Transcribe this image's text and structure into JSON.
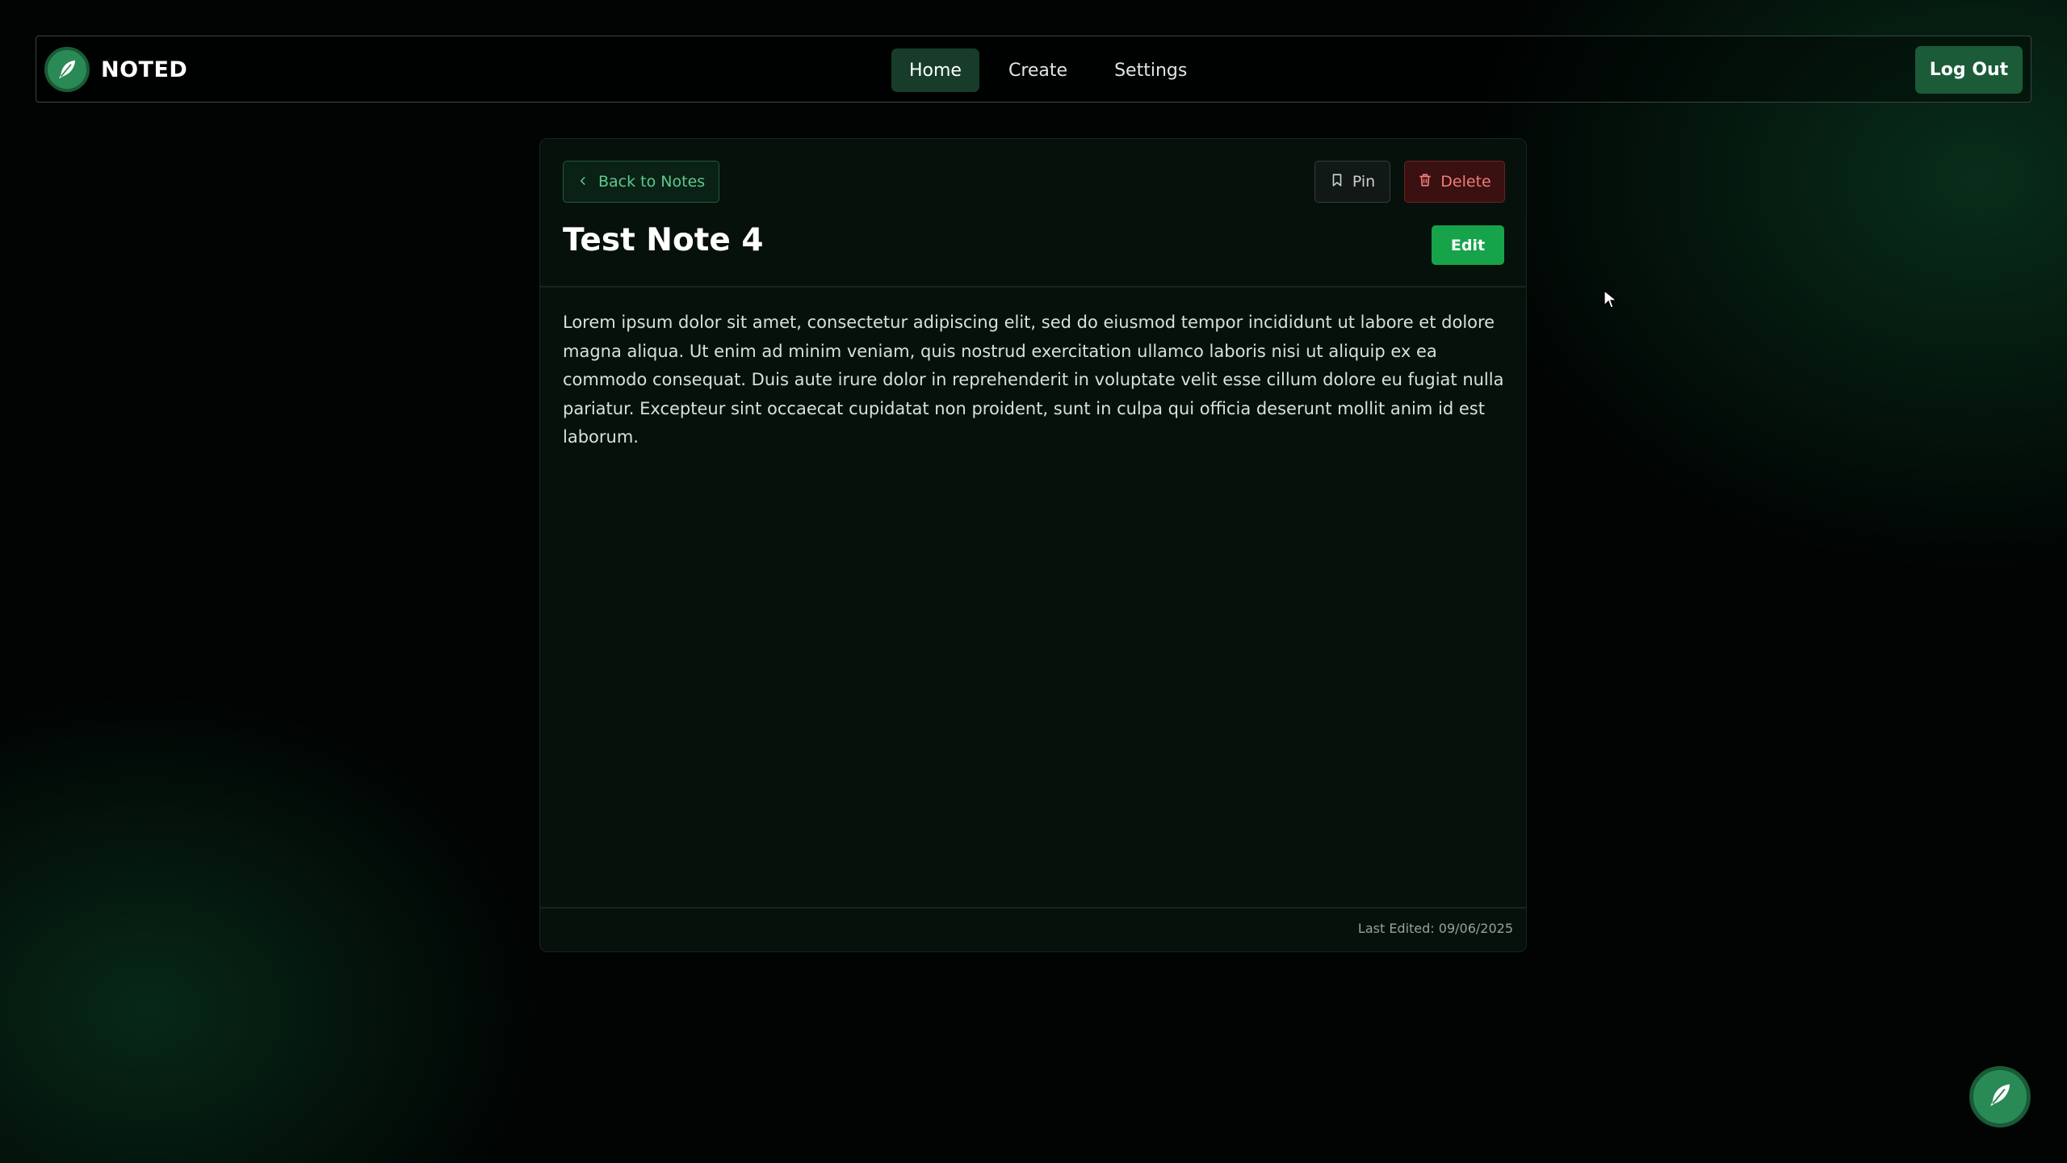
{
  "brand": {
    "name": "NOTED"
  },
  "nav": {
    "items": [
      {
        "label": "Home",
        "active": true
      },
      {
        "label": "Create",
        "active": false
      },
      {
        "label": "Settings",
        "active": false
      }
    ],
    "logout_label": "Log Out"
  },
  "note": {
    "back_label": "Back to Notes",
    "pin_label": "Pin",
    "delete_label": "Delete",
    "edit_label": "Edit",
    "title": "Test Note 4",
    "body": "Lorem ipsum dolor sit amet, consectetur adipiscing elit, sed do eiusmod tempor incididunt ut labore et dolore magna aliqua. Ut enim ad minim veniam, quis nostrud exercitation ullamco laboris nisi ut aliquip ex ea commodo consequat. Duis aute irure dolor in reprehenderit in voluptate velit esse cillum dolore eu fugiat nulla pariatur. Excepteur sint occaecat cupidatat non proident, sunt in culpa qui officia deserunt mollit anim id est laborum.",
    "last_edited": "Last Edited: 09/06/2025"
  },
  "icons": {
    "logo": "feather-icon",
    "back": "chevron-left-icon",
    "pin": "bookmark-icon",
    "delete": "trash-icon",
    "fab": "feather-icon"
  },
  "colors": {
    "accent": "#16a34a",
    "brand_green": "#2a8a55",
    "danger": "#ef7c7c"
  }
}
